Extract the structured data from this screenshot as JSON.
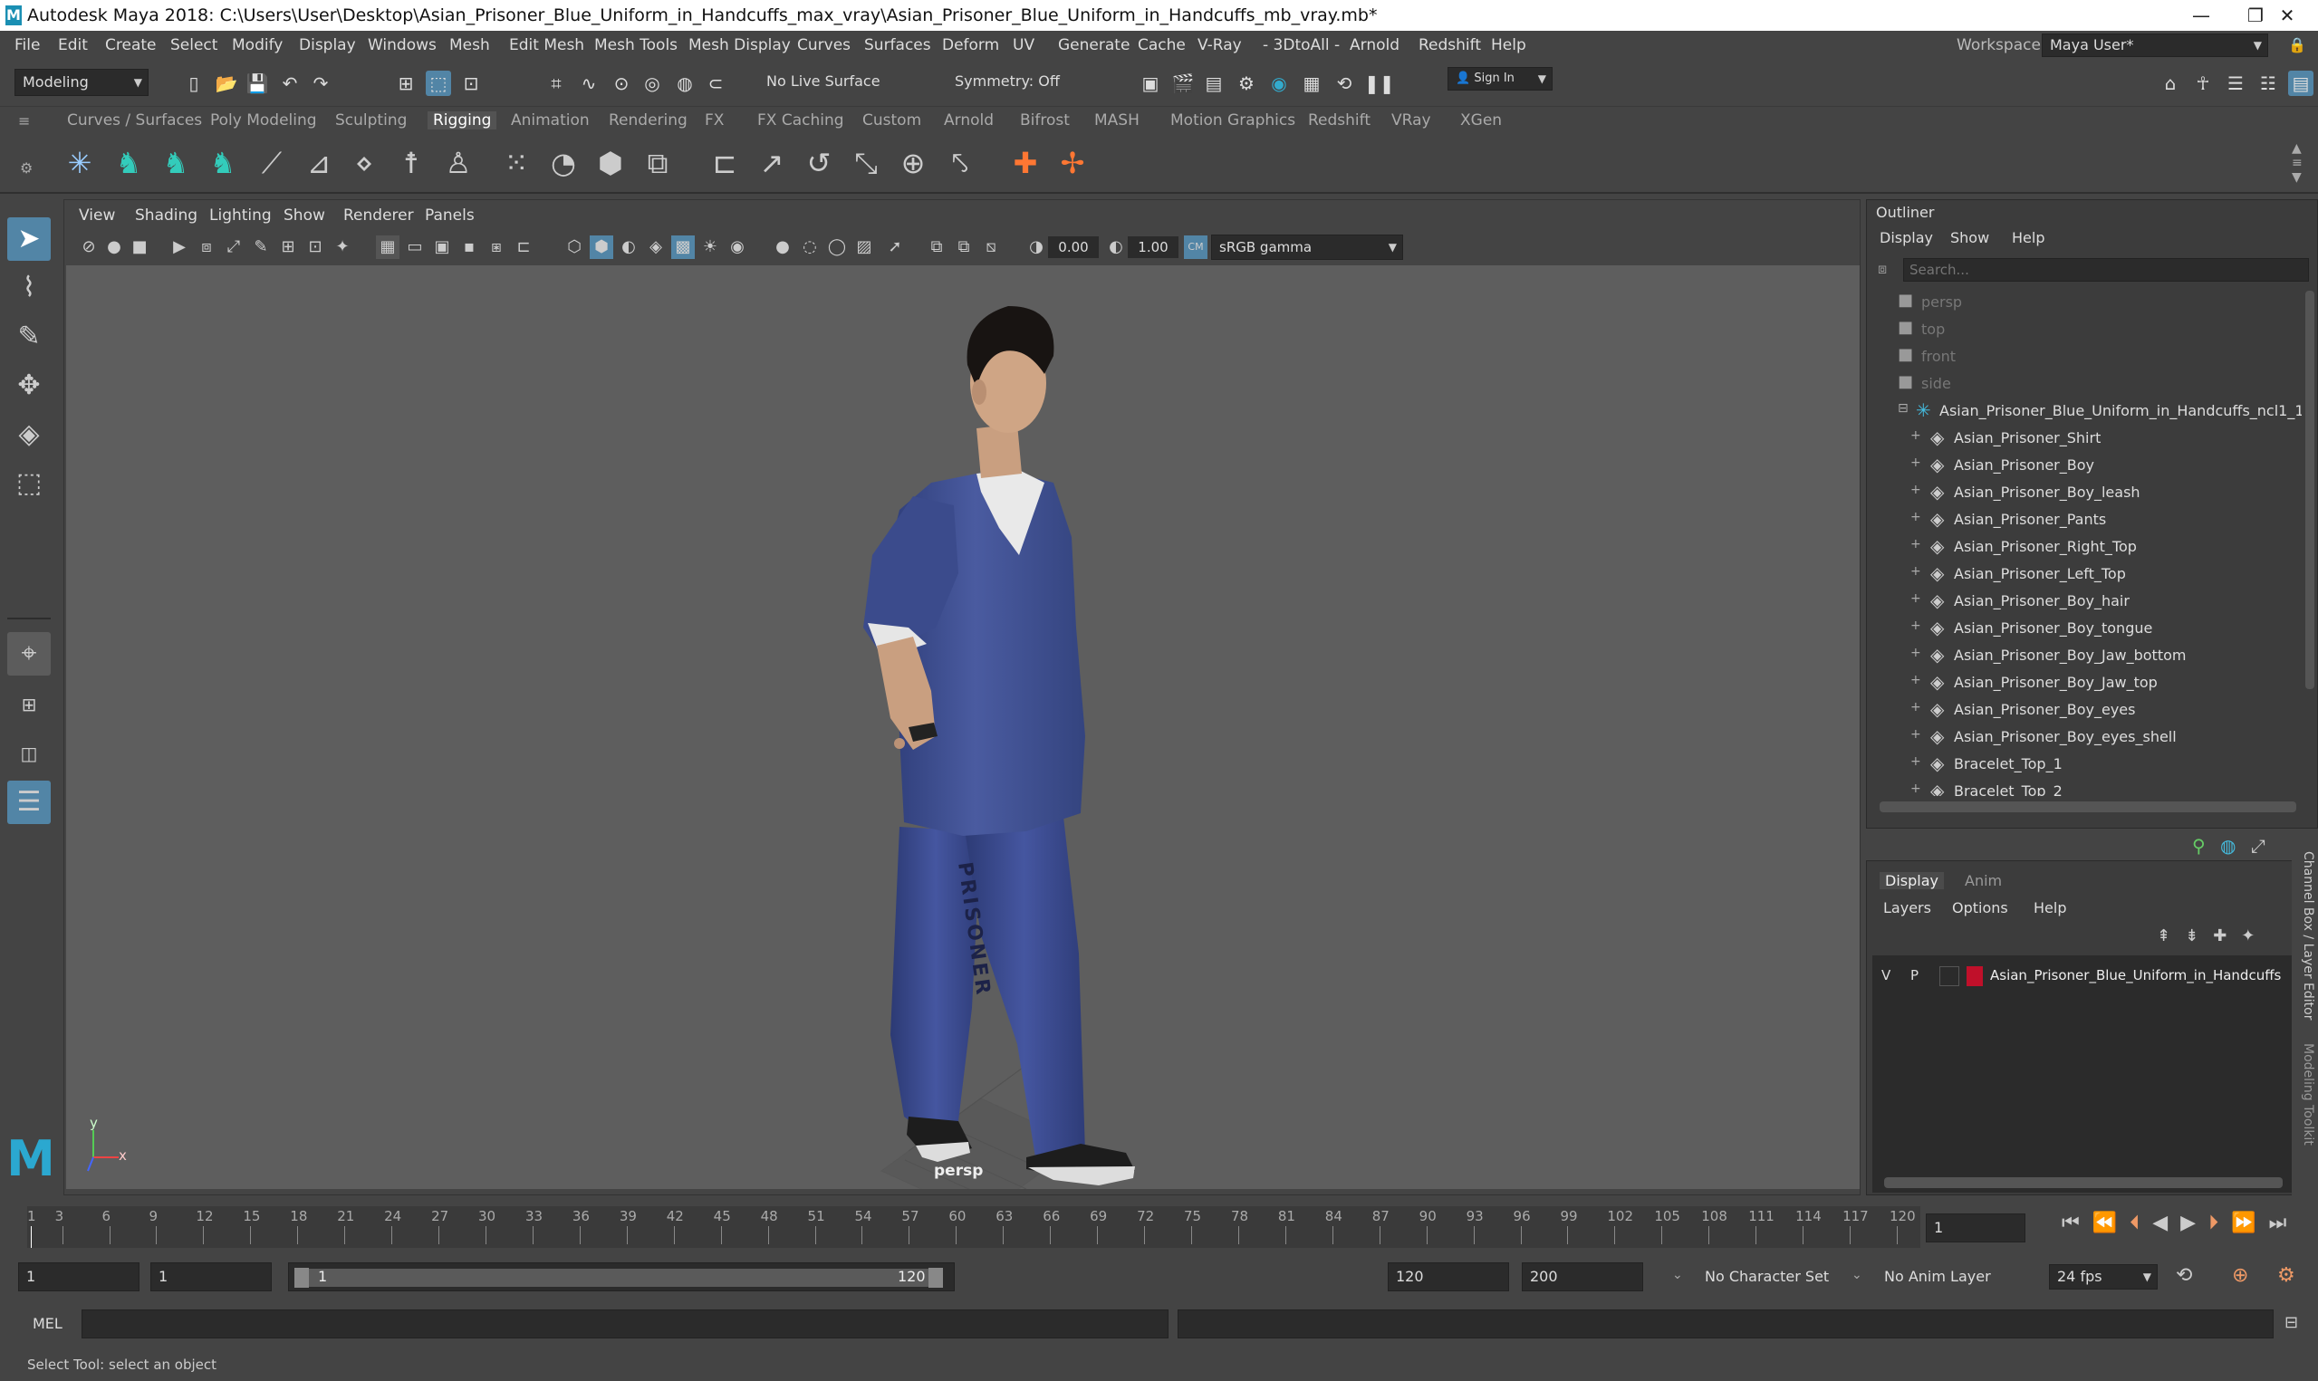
{
  "window": {
    "title": "Autodesk Maya 2018: C:\\Users\\User\\Desktop\\Asian_Prisoner_Blue_Uniform_in_Handcuffs_max_vray\\Asian_Prisoner_Blue_Uniform_in_Handcuffs_mb_vray.mb*",
    "logo": "M"
  },
  "menubar": {
    "items": [
      "File",
      "Edit",
      "Create",
      "Select",
      "Modify",
      "Display",
      "Windows",
      "Mesh",
      "Edit Mesh",
      "Mesh Tools",
      "Mesh Display",
      "Curves",
      "Surfaces",
      "Deform",
      "UV",
      "Generate",
      "Cache",
      "V-Ray",
      "- 3DtoAll -",
      "Arnold",
      "Redshift",
      "Help"
    ],
    "workspace_label": "Workspace :",
    "workspace_value": "Maya User*"
  },
  "statusline": {
    "mode": "Modeling",
    "live_surface": "No Live Surface",
    "symmetry": "Symmetry: Off",
    "sign_in": "Sign In"
  },
  "shelf": {
    "tabs": [
      "Curves / Surfaces",
      "Poly Modeling",
      "Sculpting",
      "Rigging",
      "Animation",
      "Rendering",
      "FX",
      "FX Caching",
      "Custom",
      "Arnold",
      "Bifrost",
      "MASH",
      "Motion Graphics",
      "Redshift",
      "VRay",
      "XGen"
    ],
    "active": "Rigging"
  },
  "viewport": {
    "menus": [
      "View",
      "Shading",
      "Lighting",
      "Show",
      "Renderer",
      "Panels"
    ],
    "exposure": "0.00",
    "gamma": "1.00",
    "colorspace": "sRGB gamma",
    "camera_label": "persp",
    "pants_text": "PRISONER",
    "axis_y": "y",
    "axis_x": "x"
  },
  "outliner": {
    "title": "Outliner",
    "menus": [
      "Display",
      "Show",
      "Help"
    ],
    "search_placeholder": "Search...",
    "cameras": [
      "persp",
      "top",
      "front",
      "side"
    ],
    "group": "Asian_Prisoner_Blue_Uniform_in_Handcuffs_ncl1_1",
    "children": [
      "Asian_Prisoner_Shirt",
      "Asian_Prisoner_Boy",
      "Asian_Prisoner_Boy_leash",
      "Asian_Prisoner_Pants",
      "Asian_Prisoner_Right_Top",
      "Asian_Prisoner_Left_Top",
      "Asian_Prisoner_Boy_hair",
      "Asian_Prisoner_Boy_tongue",
      "Asian_Prisoner_Boy_Jaw_bottom",
      "Asian_Prisoner_Boy_Jaw_top",
      "Asian_Prisoner_Boy_eyes",
      "Asian_Prisoner_Boy_eyes_shell",
      "Bracelet_Top_1",
      "Bracelet_Top_2"
    ]
  },
  "layer_editor": {
    "tabs": [
      "Display",
      "Anim"
    ],
    "menus": [
      "Layers",
      "Options",
      "Help"
    ],
    "layer": {
      "v": "V",
      "p": "P",
      "name": "Asian_Prisoner_Blue_Uniform_in_Handcuffs",
      "color": "#c0102a"
    }
  },
  "side_tabs": [
    "Channel Box / Layer Editor",
    "Modeling Toolkit"
  ],
  "timeline": {
    "ticks": [
      "1",
      "3",
      "6",
      "9",
      "12",
      "15",
      "18",
      "21",
      "24",
      "27",
      "30",
      "33",
      "36",
      "39",
      "42",
      "45",
      "48",
      "51",
      "54",
      "57",
      "60",
      "63",
      "66",
      "69",
      "72",
      "75",
      "78",
      "81",
      "84",
      "87",
      "90",
      "93",
      "96",
      "99",
      "102",
      "105",
      "108",
      "111",
      "114",
      "117",
      "120"
    ],
    "current_frame": "1"
  },
  "range": {
    "start": "1",
    "playback_start": "1",
    "range_left": "1",
    "range_right": "120",
    "playback_end": "120",
    "end": "200",
    "character_set": "No Character Set",
    "anim_layer": "No Anim Layer",
    "fps": "24 fps"
  },
  "cmd": {
    "label": "MEL"
  },
  "help": {
    "text": "Select Tool: select an object"
  }
}
